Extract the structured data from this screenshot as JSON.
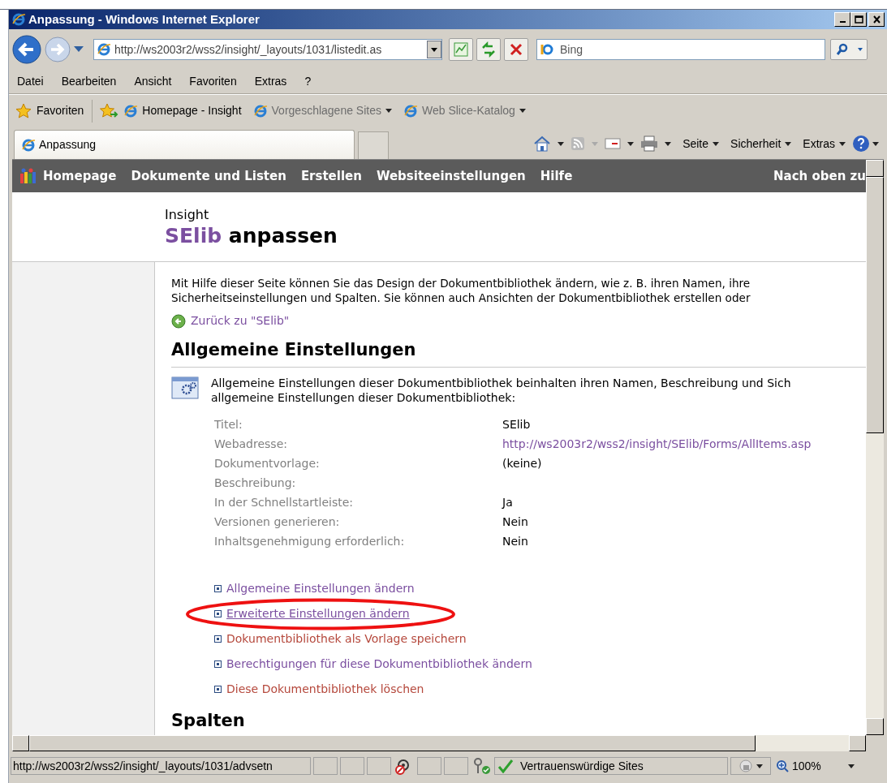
{
  "window": {
    "title": "Anpassung - Windows Internet Explorer"
  },
  "address_bar": {
    "value": "http://ws2003r2/wss2/insight/_layouts/1031/listedit.as"
  },
  "search": {
    "placeholder": "Bing"
  },
  "menu": [
    "Datei",
    "Bearbeiten",
    "Ansicht",
    "Favoriten",
    "Extras",
    "?"
  ],
  "favorites_bar": {
    "label": "Favoriten",
    "items": [
      {
        "label": "Homepage - Insight",
        "dropdown": false,
        "dimmed": false
      },
      {
        "label": "Vorgeschlagene Sites",
        "dropdown": true,
        "dimmed": true
      },
      {
        "label": "Web Slice-Katalog",
        "dropdown": true,
        "dimmed": true
      }
    ]
  },
  "tabs": [
    {
      "label": "Anpassung",
      "selected": true
    }
  ],
  "command_bar": [
    "Seite",
    "Sicherheit",
    "Extras"
  ],
  "site_nav": {
    "items": [
      "Homepage",
      "Dokumente und Listen",
      "Erstellen",
      "Websiteeinstellungen",
      "Hilfe"
    ],
    "right": "Nach oben zu"
  },
  "header": {
    "site": "Insight",
    "list_name": "SElib",
    "title_rest": "anpassen"
  },
  "intro": [
    "Mit Hilfe dieser Seite können Sie das Design der Dokumentbibliothek ändern, wie z. B. ihren Namen, ihre",
    "Sicherheitseinstellungen und Spalten. Sie können auch Ansichten der Dokumentbibliothek erstellen oder"
  ],
  "back_link": "Zurück zu \"SElib\"",
  "sections": [
    {
      "heading": "Allgemeine Einstellungen",
      "description": [
        "Allgemeine Einstellungen dieser Dokumentbibliothek beinhalten ihren Namen, Beschreibung und Sich",
        "allgemeine Einstellungen dieser Dokumentbibliothek:"
      ],
      "properties": [
        {
          "label": "Titel:",
          "value": "SElib",
          "kind": "text"
        },
        {
          "label": "Webadresse:",
          "value": "http://ws2003r2/wss2/insight/SElib/Forms/AllItems.asp",
          "kind": "link"
        },
        {
          "label": "Dokumentvorlage:",
          "value": "(keine)",
          "kind": "text"
        },
        {
          "label": "Beschreibung:",
          "kind": "text"
        },
        {
          "label": "In der Schnellstartleiste:",
          "value": "Ja",
          "kind": "text"
        },
        {
          "label": "Versionen generieren:",
          "value": "Nein",
          "kind": "text"
        },
        {
          "label": "Inhaltsgenehmigung erforderlich:",
          "value": "Nein",
          "kind": "text"
        }
      ],
      "links": [
        {
          "label": "Allgemeine Einstellungen ändern",
          "visited": true,
          "hovered": false,
          "circled": false
        },
        {
          "label": "Erweiterte Einstellungen ändern",
          "visited": true,
          "hovered": true,
          "circled": true
        },
        {
          "label": "Dokumentbibliothek als Vorlage speichern",
          "visited": false,
          "hovered": false,
          "circled": false
        },
        {
          "label": "Berechtigungen für diese Dokumentbibliothek ändern",
          "visited": true,
          "hovered": false,
          "circled": false
        },
        {
          "label": "Diese Dokumentbibliothek löschen",
          "visited": false,
          "hovered": false,
          "circled": false
        }
      ]
    },
    {
      "heading": "Spalten"
    }
  ],
  "status_bar": {
    "url": "http://ws2003r2/wss2/insight/_layouts/1031/advsetn",
    "zone": "Vertrauenswürdige Sites",
    "zoom": "100%"
  }
}
